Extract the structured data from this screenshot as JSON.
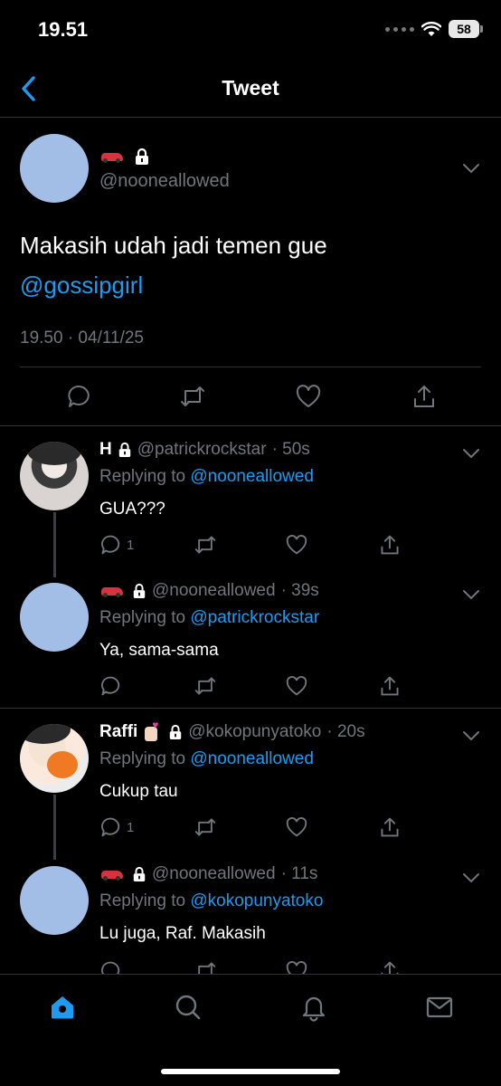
{
  "status_bar": {
    "time": "19.51",
    "battery": "58"
  },
  "nav": {
    "title": "Tweet"
  },
  "main_tweet": {
    "handle": "@nooneallowed",
    "text": "Makasih udah jadi temen gue",
    "mention": "@gossipgirl",
    "timestamp": "19.50 · 04/11/25"
  },
  "replies": [
    {
      "name": "H",
      "handle": "@patrickrockstar",
      "time": "· 50s",
      "replying_prefix": "Replying to ",
      "replying_to": "@nooneallowed",
      "text": "GUA???",
      "reply_count": "1"
    },
    {
      "name": "",
      "handle": "@nooneallowed",
      "time": "· 39s",
      "replying_prefix": "Replying to ",
      "replying_to": "@patrickrockstar",
      "text": "Ya, sama-sama",
      "reply_count": ""
    },
    {
      "name": "Raffi",
      "handle": "@kokopunyatoko",
      "time": "· 20s",
      "replying_prefix": "Replying to ",
      "replying_to": "@nooneallowed",
      "text": "Cukup tau",
      "reply_count": "1"
    },
    {
      "name": "",
      "handle": "@nooneallowed",
      "time": "· 11s",
      "replying_prefix": "Replying to ",
      "replying_to": "@kokopunyatoko",
      "text": "Lu juga, Raf. Makasih",
      "reply_count": ""
    }
  ],
  "icons": {
    "back": "chevron-left-icon",
    "lock": "lock-icon",
    "reply": "reply-icon",
    "retweet": "retweet-icon",
    "like": "heart-icon",
    "share": "share-icon",
    "home": "home-icon",
    "search": "search-icon",
    "notifications": "bell-icon",
    "messages": "mail-icon"
  },
  "colors": {
    "accent": "#1d9bf0",
    "background": "#000000",
    "muted": "#71767b",
    "divider": "#2f3336"
  }
}
